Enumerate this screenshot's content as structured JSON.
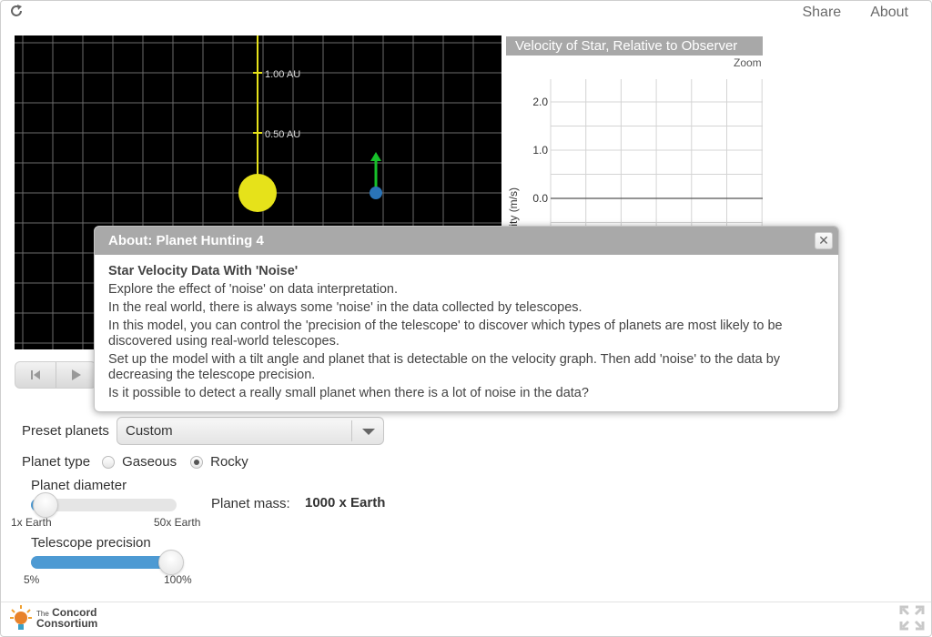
{
  "topbar": {
    "reload_icon": "reload-icon",
    "share_label": "Share",
    "about_label": "About"
  },
  "orbit_view": {
    "distance_labels": [
      "1.00 AU",
      "0.50 AU"
    ],
    "star_color": "#e6e21a",
    "planet_color": "#2a74b8",
    "velocity_arrow_color": "#17c02a"
  },
  "graph": {
    "title": "Velocity of Star, Relative to Observer",
    "zoom_label": "Zoom",
    "ylabel": "Velocity (m/s)",
    "yticks": [
      "2.0",
      "1.0",
      "0.0"
    ]
  },
  "chart_data": {
    "type": "line",
    "title": "Velocity of Star, Relative to Observer",
    "ylabel": "Velocity (m/s)",
    "xlabel": "",
    "y_ticks": [
      2.0,
      1.0,
      0.0
    ],
    "ylim": [
      -2.5,
      2.5
    ],
    "grid": true,
    "series": [
      {
        "values": [
          0.0,
          0.0,
          0.0,
          0.0,
          0.0,
          0.0,
          0.0,
          0.0
        ]
      }
    ]
  },
  "playback": {
    "reset_icon": "reset-icon",
    "play_icon": "play-icon"
  },
  "controls": {
    "preset_label": "Preset planets",
    "preset_value": "Custom",
    "planet_type_label": "Planet type",
    "planet_types": [
      "Gaseous",
      "Rocky"
    ],
    "planet_type_selected": "Rocky",
    "diameter_label": "Planet diameter",
    "diameter_min": "1x Earth",
    "diameter_max": "50x Earth",
    "diameter_level": 0.1,
    "mass_label": "Planet mass:",
    "mass_value": "1000 x Earth",
    "precision_label": "Telescope precision",
    "precision_min": "5%",
    "precision_max": "100%",
    "precision_level": 1.0
  },
  "dialog": {
    "title": "About: Planet Hunting 4",
    "close_icon": "close-icon",
    "heading": "Star Velocity Data With 'Noise'",
    "paragraphs": [
      "Explore the effect of 'noise' on data interpretation.",
      "In the real world, there is always some 'noise' in the data collected by telescopes.",
      "In this model, you can control the 'precision of the telescope' to discover which types of planets are most likely to be discovered using real-world telescopes.",
      "Set up the model with a tilt angle and planet that is detectable on the velocity graph. Then add 'noise' to the data by decreasing the telescope precision.",
      "Is it possible to detect a really small planet when there is a lot of noise in the data?"
    ]
  },
  "footer": {
    "logo_line1": "The",
    "logo_line1b": "Concord",
    "logo_line2": "Consortium",
    "fullscreen_icon": "fullscreen-icon"
  }
}
